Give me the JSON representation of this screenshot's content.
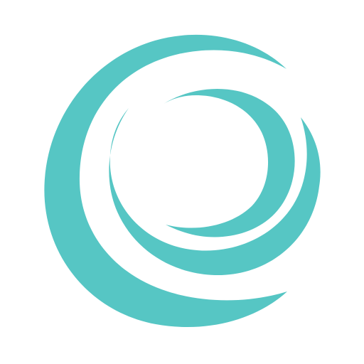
{
  "logo": {
    "icon": "concentric-crescent-swirl-logo",
    "colors": {
      "mark": "#56c6c4",
      "background": "#ffffff"
    }
  }
}
